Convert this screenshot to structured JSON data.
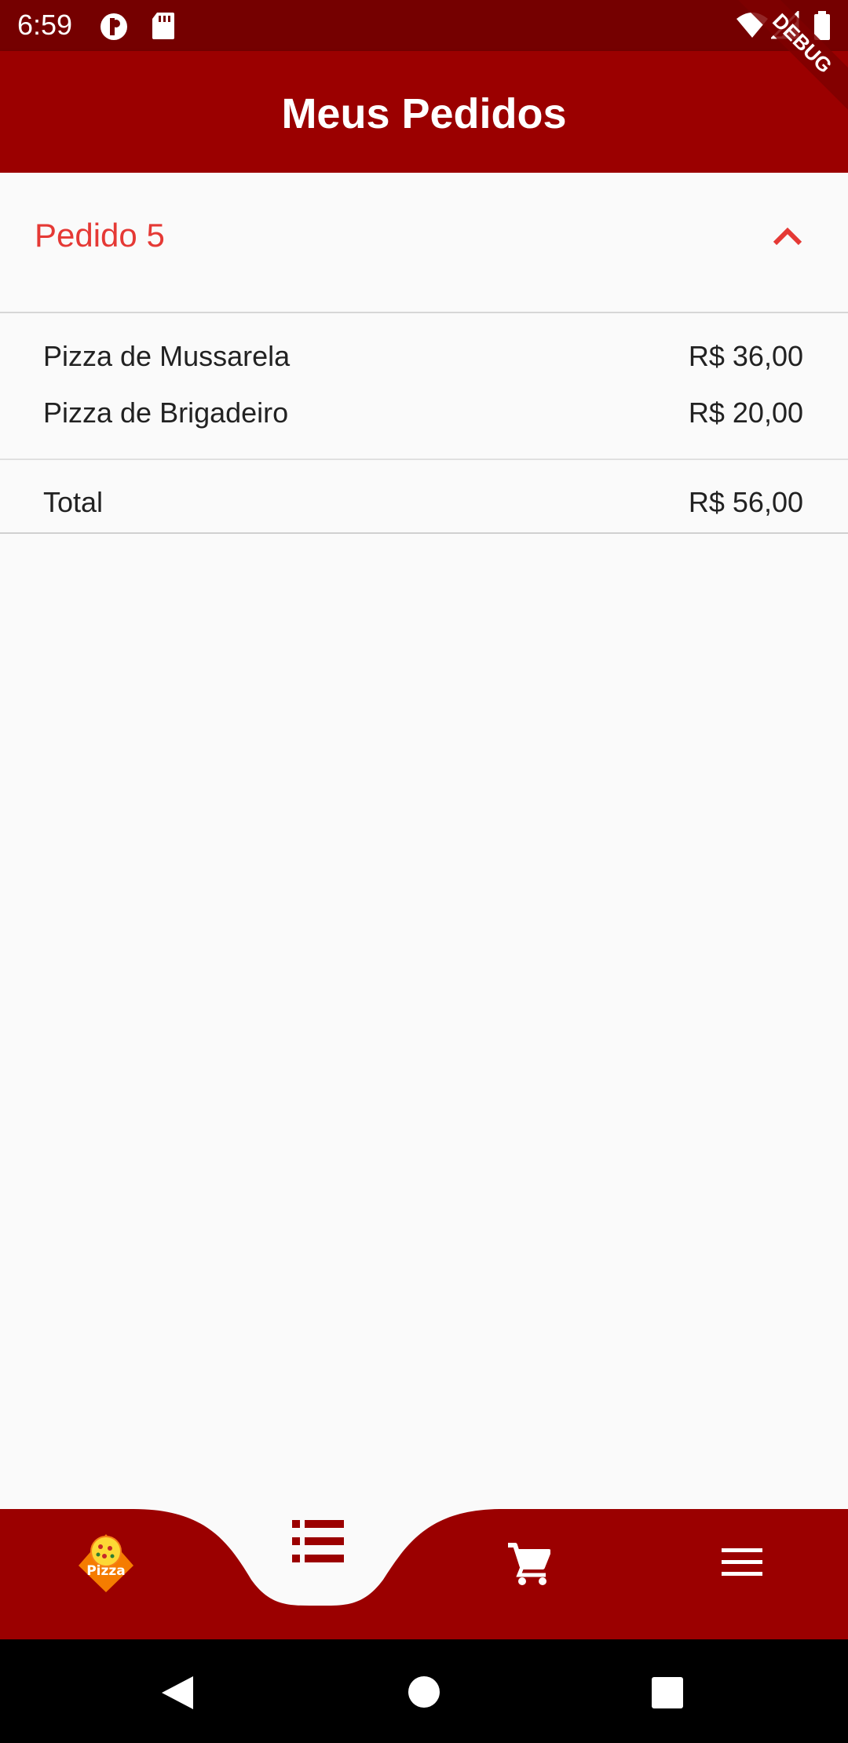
{
  "status_bar": {
    "time": "6:59",
    "icons": [
      "vpn-key-icon",
      "sd-card-icon",
      "wifi-icon",
      "signal-icon",
      "battery-icon"
    ]
  },
  "app_bar": {
    "title": "Meus Pedidos"
  },
  "debug_banner": {
    "label": "DEBUG"
  },
  "order": {
    "title": "Pedido 5",
    "expanded": true,
    "items": [
      {
        "name": "Pizza de Mussarela",
        "price": "R$ 36,00"
      },
      {
        "name": "Pizza de Brigadeiro",
        "price": "R$ 20,00"
      }
    ],
    "total_label": "Total",
    "total_value": "R$ 56,00"
  },
  "bottom_nav": {
    "items": [
      "pizza-logo-icon",
      "list-icon",
      "cart-icon",
      "menu-icon"
    ],
    "active_index": 1,
    "logo_text": "Pizza"
  },
  "system_nav": [
    "back-icon",
    "home-icon",
    "recents-icon"
  ],
  "colors": {
    "primary": "#9b0000",
    "status_bar": "#750000",
    "accent": "#e53935",
    "background": "#fafafa"
  }
}
